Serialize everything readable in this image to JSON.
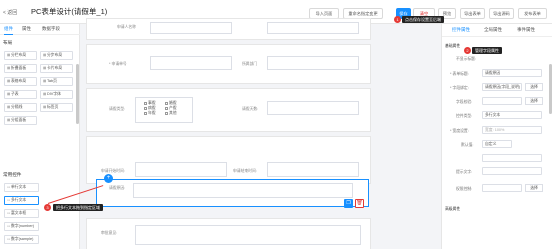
{
  "topbar": {
    "back": "< 返回",
    "title": "PC表单设计(请假单_1)",
    "import": "导入页面",
    "rename": "重命名指定变更",
    "save": "保存",
    "clear": "清空",
    "preview": "预览",
    "export": "导出表单",
    "export2": "导出源码",
    "publish": "发布表单"
  },
  "left": {
    "tabs": [
      "组件",
      "属性",
      "数据字段"
    ],
    "section_layout": "布局",
    "layout_items": [
      "分栏布局",
      "分步布局",
      "折叠面板",
      "卡片布局",
      "表格布局",
      "Tab页",
      "子表",
      "DIV字体",
      "分隔线",
      "标签页",
      "分组面板"
    ],
    "section_common": "常用控件",
    "common_items": [
      "单行文本",
      "多行文本",
      "富文本框",
      "数字(number)",
      "数字(sample)"
    ]
  },
  "canvas": {
    "fields": [
      "申请人名称",
      "* 申请单号",
      "所属部门",
      "请假类型:",
      "请假天数:",
      "申请开始时间:",
      "申请结束时间:",
      "请假原因:",
      "审批意见:"
    ],
    "options": [
      "事假",
      "病假",
      "年假",
      "婚假",
      "产假",
      "其他"
    ]
  },
  "right": {
    "tabs": [
      "控件属性",
      "全局属性",
      "事件属性"
    ],
    "section": "基础属性",
    "rows": [
      {
        "label": "不显示标题:",
        "value": ""
      },
      {
        "label": "* 表单标题:",
        "value": "请假原因"
      },
      {
        "label": "* 字段绑定:",
        "value": "请假原因(字段_说明)"
      },
      {
        "label": "字段校验:",
        "value": ""
      },
      {
        "label": "控件类型:",
        "value": "多行文本"
      },
      {
        "label": "* 宽度设置:",
        "value": "宽度: 100%"
      },
      {
        "label": "默认值:",
        "value": "自定义"
      },
      {
        "label": "提示文字:",
        "value": ""
      },
      {
        "label": "权限控制:",
        "value": ""
      }
    ],
    "btn_edit": "选择",
    "section2": "高级属性"
  },
  "tips": {
    "save_tip": "点击保存设置至后端",
    "rename_tip": "管理字段属性",
    "drag_tip": "把多行文本拖到指定区域"
  },
  "badges": [
    "1",
    "2",
    "3"
  ]
}
